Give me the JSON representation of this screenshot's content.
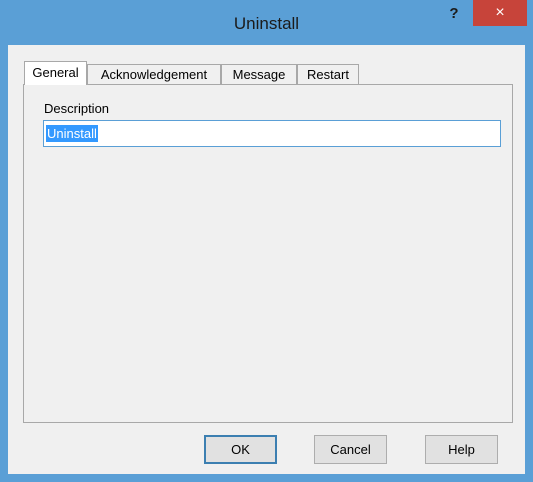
{
  "window": {
    "title": "Uninstall",
    "help_glyph": "?",
    "close_glyph": "×"
  },
  "tabs": [
    {
      "label": "General",
      "active": true
    },
    {
      "label": "Acknowledgement",
      "active": false
    },
    {
      "label": "Message",
      "active": false
    },
    {
      "label": "Restart",
      "active": false
    }
  ],
  "general": {
    "description_label": "Description",
    "description_value": "Uninstall"
  },
  "buttons": {
    "ok": "OK",
    "cancel": "Cancel",
    "help": "Help"
  },
  "colors": {
    "titlebar": "#5a9fd6",
    "close_button": "#c7443a",
    "selection": "#3399ff"
  }
}
